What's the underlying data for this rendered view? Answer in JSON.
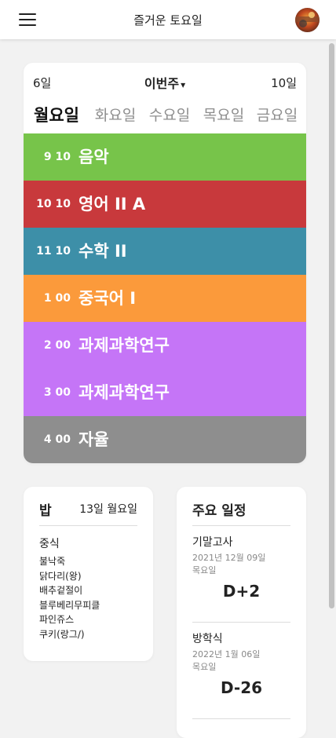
{
  "app": {
    "title": "즐거운 토요일"
  },
  "timetable": {
    "prev_week": "6일",
    "current_week": "이번주",
    "week_caret": "▾",
    "next_week": "10일",
    "days": [
      "월요일",
      "화요일",
      "수요일",
      "목요일",
      "금요일"
    ],
    "active_day_index": 0,
    "periods": [
      {
        "time": "9 10",
        "name": "음악",
        "color": "#77c44a"
      },
      {
        "time": "10 10",
        "name": "영어 II A",
        "color": "#c8393c"
      },
      {
        "time": "11 10",
        "name": "수학 II",
        "color": "#3d8fa8"
      },
      {
        "time": "1 00",
        "name": "중국어 I",
        "color": "#fb9a3b"
      },
      {
        "time": "2 00",
        "name": "과제과학연구",
        "color": "#c575f7"
      },
      {
        "time": "3 00",
        "name": "과제과학연구",
        "color": "#c575f7"
      },
      {
        "time": "4 00",
        "name": "자율",
        "color": "#8e8e8e"
      }
    ]
  },
  "meal": {
    "title": "밥",
    "date": "13일 월요일",
    "type": "중식",
    "items": [
      "불낙죽",
      "닭다리(왕)",
      "배추겉절이",
      "블루베리무피클",
      "파인쥬스",
      "쿠키(랑그/)"
    ]
  },
  "schedule": {
    "title": "주요 일정",
    "events": [
      {
        "name": "기말고사",
        "date": "2021년 12월 09일",
        "weekday": "목요일",
        "dday": "D+2"
      },
      {
        "name": "방학식",
        "date": "2022년 1월 06일",
        "weekday": "목요일",
        "dday": "D-26"
      }
    ]
  }
}
